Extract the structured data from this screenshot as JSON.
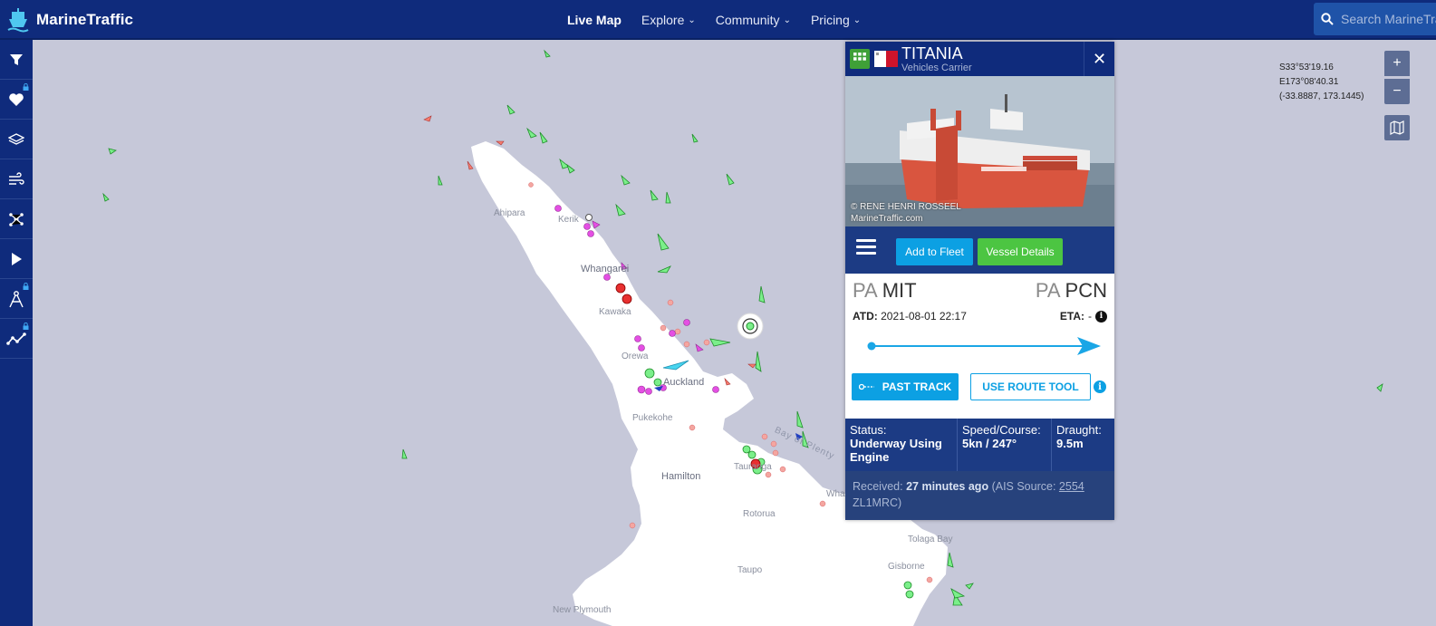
{
  "app": {
    "logo_text": "MarineTraffic"
  },
  "nav": {
    "items": [
      {
        "label": "Live Map",
        "active": true,
        "dropdown": false
      },
      {
        "label": "Explore",
        "active": false,
        "dropdown": true
      },
      {
        "label": "Community",
        "active": false,
        "dropdown": true
      },
      {
        "label": "Pricing",
        "active": false,
        "dropdown": true
      }
    ]
  },
  "search": {
    "placeholder": "Search MarineTraffic"
  },
  "sidebar": {
    "items": [
      {
        "icon": "filter-icon",
        "locked": false
      },
      {
        "icon": "heart-icon",
        "locked": true
      },
      {
        "icon": "layers-icon",
        "locked": false
      },
      {
        "icon": "wind-icon",
        "locked": false
      },
      {
        "icon": "density-icon",
        "locked": false
      },
      {
        "icon": "play-icon",
        "locked": false
      },
      {
        "icon": "measure-icon",
        "locked": true
      },
      {
        "icon": "route-icon",
        "locked": true
      }
    ]
  },
  "map": {
    "coords": {
      "lat": "S33°53'19.16",
      "lon": "E173°08'40.31",
      "decimal": "(-33.8887, 173.1445)"
    },
    "zoom_in": "+",
    "zoom_out": "−",
    "places": [
      {
        "key": "ahipara",
        "label": "Ahipara"
      },
      {
        "key": "kerikeri",
        "label": "Kerik"
      },
      {
        "key": "whangarei",
        "label": "Whangarei"
      },
      {
        "key": "kawaka",
        "label": "Kawaka"
      },
      {
        "key": "orewa",
        "label": "Orewa"
      },
      {
        "key": "auckland",
        "label": "Auckland"
      },
      {
        "key": "pukekohe",
        "label": "Pukekohe"
      },
      {
        "key": "hamilton",
        "label": "Hamilton"
      },
      {
        "key": "tauranga",
        "label": "Tauranga"
      },
      {
        "key": "bay_of_plenty",
        "label": "Bay of Plenty"
      },
      {
        "key": "rotorua",
        "label": "Rotorua"
      },
      {
        "key": "whakatane",
        "label": "Whakatane"
      },
      {
        "key": "taupo",
        "label": "Taupo"
      },
      {
        "key": "tolaga_bay",
        "label": "Tolaga Bay"
      },
      {
        "key": "gisborne",
        "label": "Gisborne"
      },
      {
        "key": "new_plymouth",
        "label": "New Plymouth"
      }
    ]
  },
  "vessel": {
    "name": "TITANIA",
    "type": "Vehicles Carrier",
    "flag": "Malta",
    "photo_credit_1": "© RENE HENRI ROSSEEL",
    "photo_credit_2": "MarineTraffic.com",
    "actions": {
      "add_to_fleet": "Add to Fleet",
      "vessel_details": "Vessel Details"
    },
    "departure": {
      "country": "PA",
      "port": "MIT"
    },
    "arrival": {
      "country": "PA",
      "port": "PCN"
    },
    "atd_label": "ATD:",
    "atd_value": "2021-08-01 22:17",
    "eta_label": "ETA:",
    "eta_value": "-",
    "past_track": "PAST TRACK",
    "route_tool": "USE ROUTE TOOL",
    "status_label": "Status:",
    "status_value": "Underway Using Engine",
    "speed_label": "Speed/Course:",
    "speed_value": "5kn / 247°",
    "draught_label": "Draught:",
    "draught_value": "9.5m",
    "received_label": "Received:",
    "received_value": "27 minutes ago",
    "ais_source_label": "(AIS Source:",
    "ais_source_id": "2554",
    "ais_source_name": "ZL1MRC)",
    "colors": {
      "header": "#0f2b7c",
      "accent_blue": "#0ca0e3",
      "accent_green": "#4cc542",
      "hull": "#d9553f"
    }
  }
}
